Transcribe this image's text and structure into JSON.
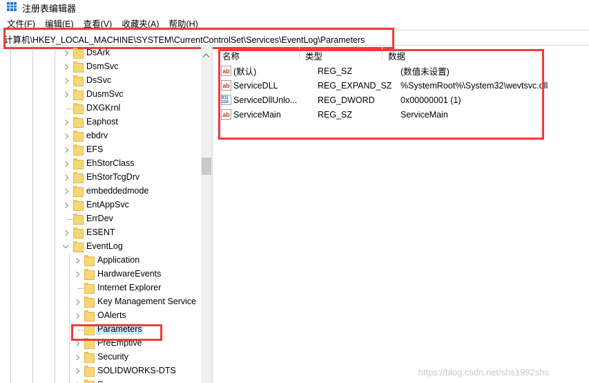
{
  "window": {
    "title": "注册表编辑器"
  },
  "menu": [
    "文件(F)",
    "编辑(E)",
    "查看(V)",
    "收藏夹(A)",
    "帮助(H)"
  ],
  "address": "计算机\\HKEY_LOCAL_MACHINE\\SYSTEM\\CurrentControlSet\\Services\\EventLog\\Parameters",
  "tree": [
    {
      "label": "DsArk",
      "level": 1,
      "expandable": true
    },
    {
      "label": "DsmSvc",
      "level": 1,
      "expandable": true
    },
    {
      "label": "DsSvc",
      "level": 1,
      "expandable": true
    },
    {
      "label": "DusmSvc",
      "level": 1,
      "expandable": true
    },
    {
      "label": "DXGKrnl",
      "level": 1,
      "expandable": false
    },
    {
      "label": "Eaphost",
      "level": 1,
      "expandable": true
    },
    {
      "label": "ebdrv",
      "level": 1,
      "expandable": true
    },
    {
      "label": "EFS",
      "level": 1,
      "expandable": true
    },
    {
      "label": "EhStorClass",
      "level": 1,
      "expandable": true
    },
    {
      "label": "EhStorTcgDrv",
      "level": 1,
      "expandable": true
    },
    {
      "label": "embeddedmode",
      "level": 1,
      "expandable": true
    },
    {
      "label": "EntAppSvc",
      "level": 1,
      "expandable": true
    },
    {
      "label": "ErrDev",
      "level": 1,
      "expandable": false
    },
    {
      "label": "ESENT",
      "level": 1,
      "expandable": true
    },
    {
      "label": "EventLog",
      "level": 1,
      "expandable": true,
      "open": true
    },
    {
      "label": "Application",
      "level": 2,
      "expandable": true
    },
    {
      "label": "HardwareEvents",
      "level": 2,
      "expandable": true
    },
    {
      "label": "Internet Explorer",
      "level": 2,
      "expandable": false
    },
    {
      "label": "Key Management Service",
      "level": 2,
      "expandable": true
    },
    {
      "label": "OAlerts",
      "level": 2,
      "expandable": true
    },
    {
      "label": "Parameters",
      "level": 2,
      "expandable": false,
      "selected": true
    },
    {
      "label": "PreEmptive",
      "level": 2,
      "expandable": true
    },
    {
      "label": "Security",
      "level": 2,
      "expandable": true
    },
    {
      "label": "SOLIDWORKS-DTS",
      "level": 2,
      "expandable": true
    },
    {
      "label": "S",
      "level": 2,
      "expandable": true
    }
  ],
  "columns": [
    "名称",
    "类型",
    "数据"
  ],
  "values": [
    {
      "name": "(默认)",
      "type": "REG_SZ",
      "data": "(数值未设置)",
      "icon": "ab"
    },
    {
      "name": "ServiceDLL",
      "type": "REG_EXPAND_SZ",
      "data": "%SystemRoot%\\System32\\wevtsvc.dll",
      "icon": "ab"
    },
    {
      "name": "ServiceDllUnlo...",
      "type": "REG_DWORD",
      "data": "0x00000001 (1)",
      "icon": "bin"
    },
    {
      "name": "ServiceMain",
      "type": "REG_SZ",
      "data": "ServiceMain",
      "icon": "ab"
    }
  ],
  "watermark": "https://blog.csdn.net/shs1992shs"
}
